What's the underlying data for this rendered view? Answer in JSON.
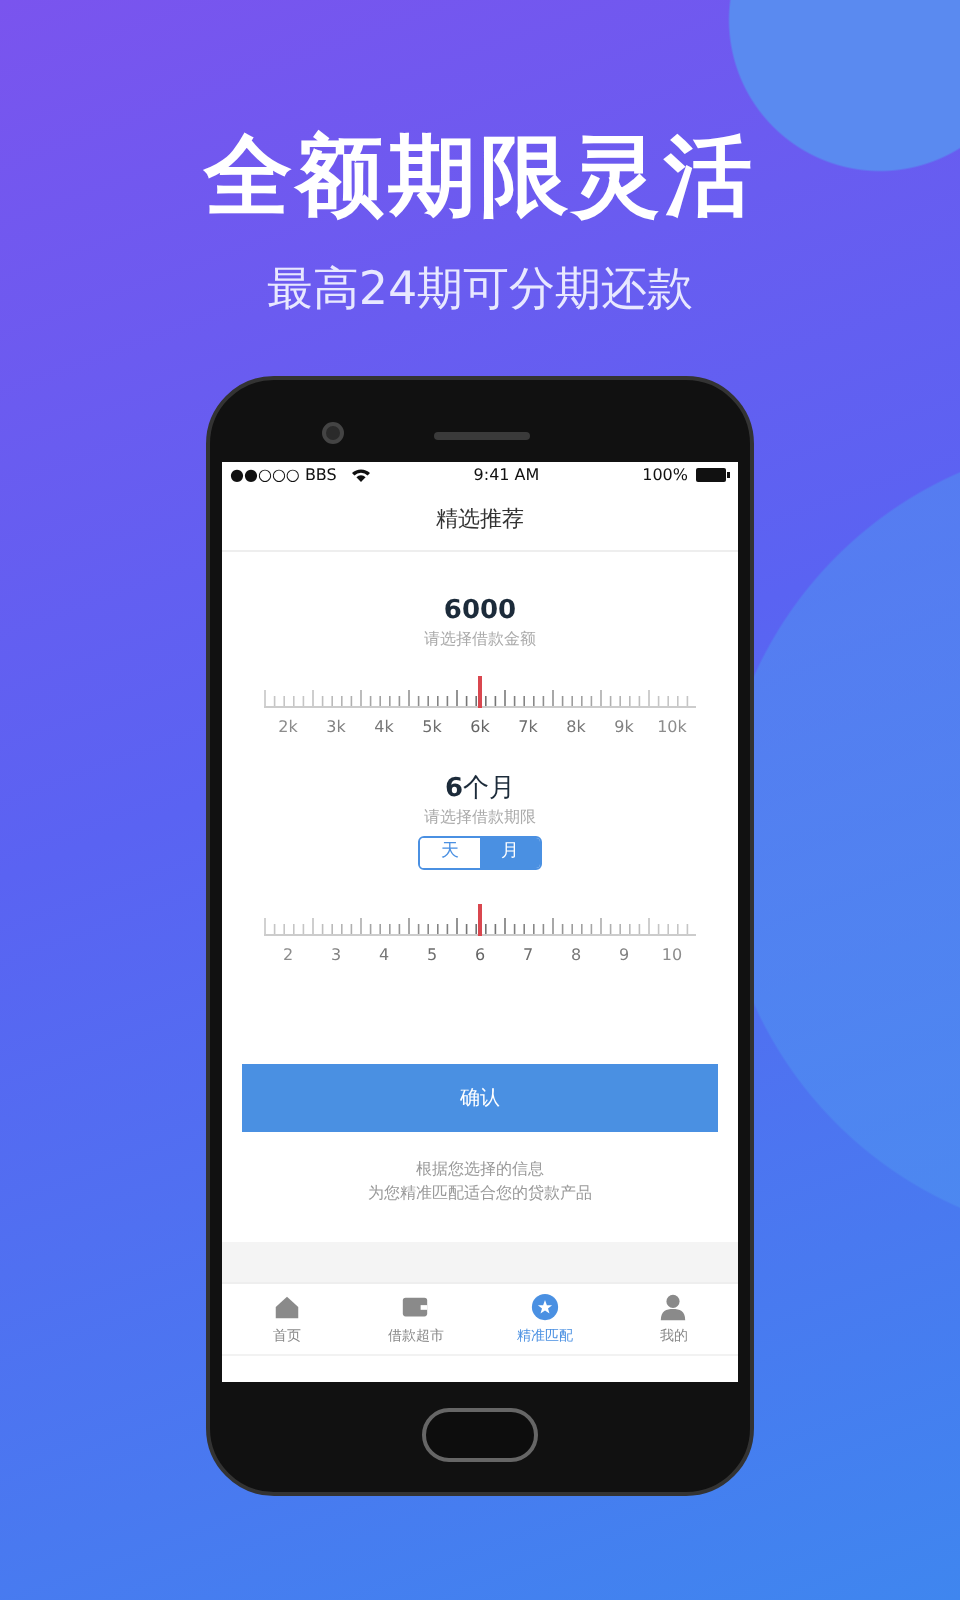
{
  "headline": "全额期限灵活",
  "subheadline": "最高24期可分期还款",
  "status_bar": {
    "carrier": "●●○○○ BBS",
    "time": "9:41 AM",
    "battery": "100%"
  },
  "nav_title": "精选推荐",
  "amount": {
    "value": "6000",
    "hint": "请选择借款金额",
    "labels": [
      "2k",
      "3k",
      "4k",
      "5k",
      "6k",
      "7k",
      "8k",
      "9k",
      "10k"
    ]
  },
  "term": {
    "value": "6",
    "unit": "个月",
    "hint": "请选择借款期限",
    "units": [
      {
        "label": "天",
        "selected": false
      },
      {
        "label": "月",
        "selected": true
      }
    ],
    "labels": [
      "2",
      "3",
      "4",
      "5",
      "6",
      "7",
      "8",
      "9",
      "10"
    ]
  },
  "confirm_button": "确认",
  "note": [
    "根据您选择的信息",
    "为您精准匹配适合您的贷款产品"
  ],
  "tabs": [
    {
      "label": "首页",
      "selected": false
    },
    {
      "label": "借款超市",
      "selected": false
    },
    {
      "label": "精准匹配",
      "selected": true
    },
    {
      "label": "我的",
      "selected": false
    }
  ]
}
